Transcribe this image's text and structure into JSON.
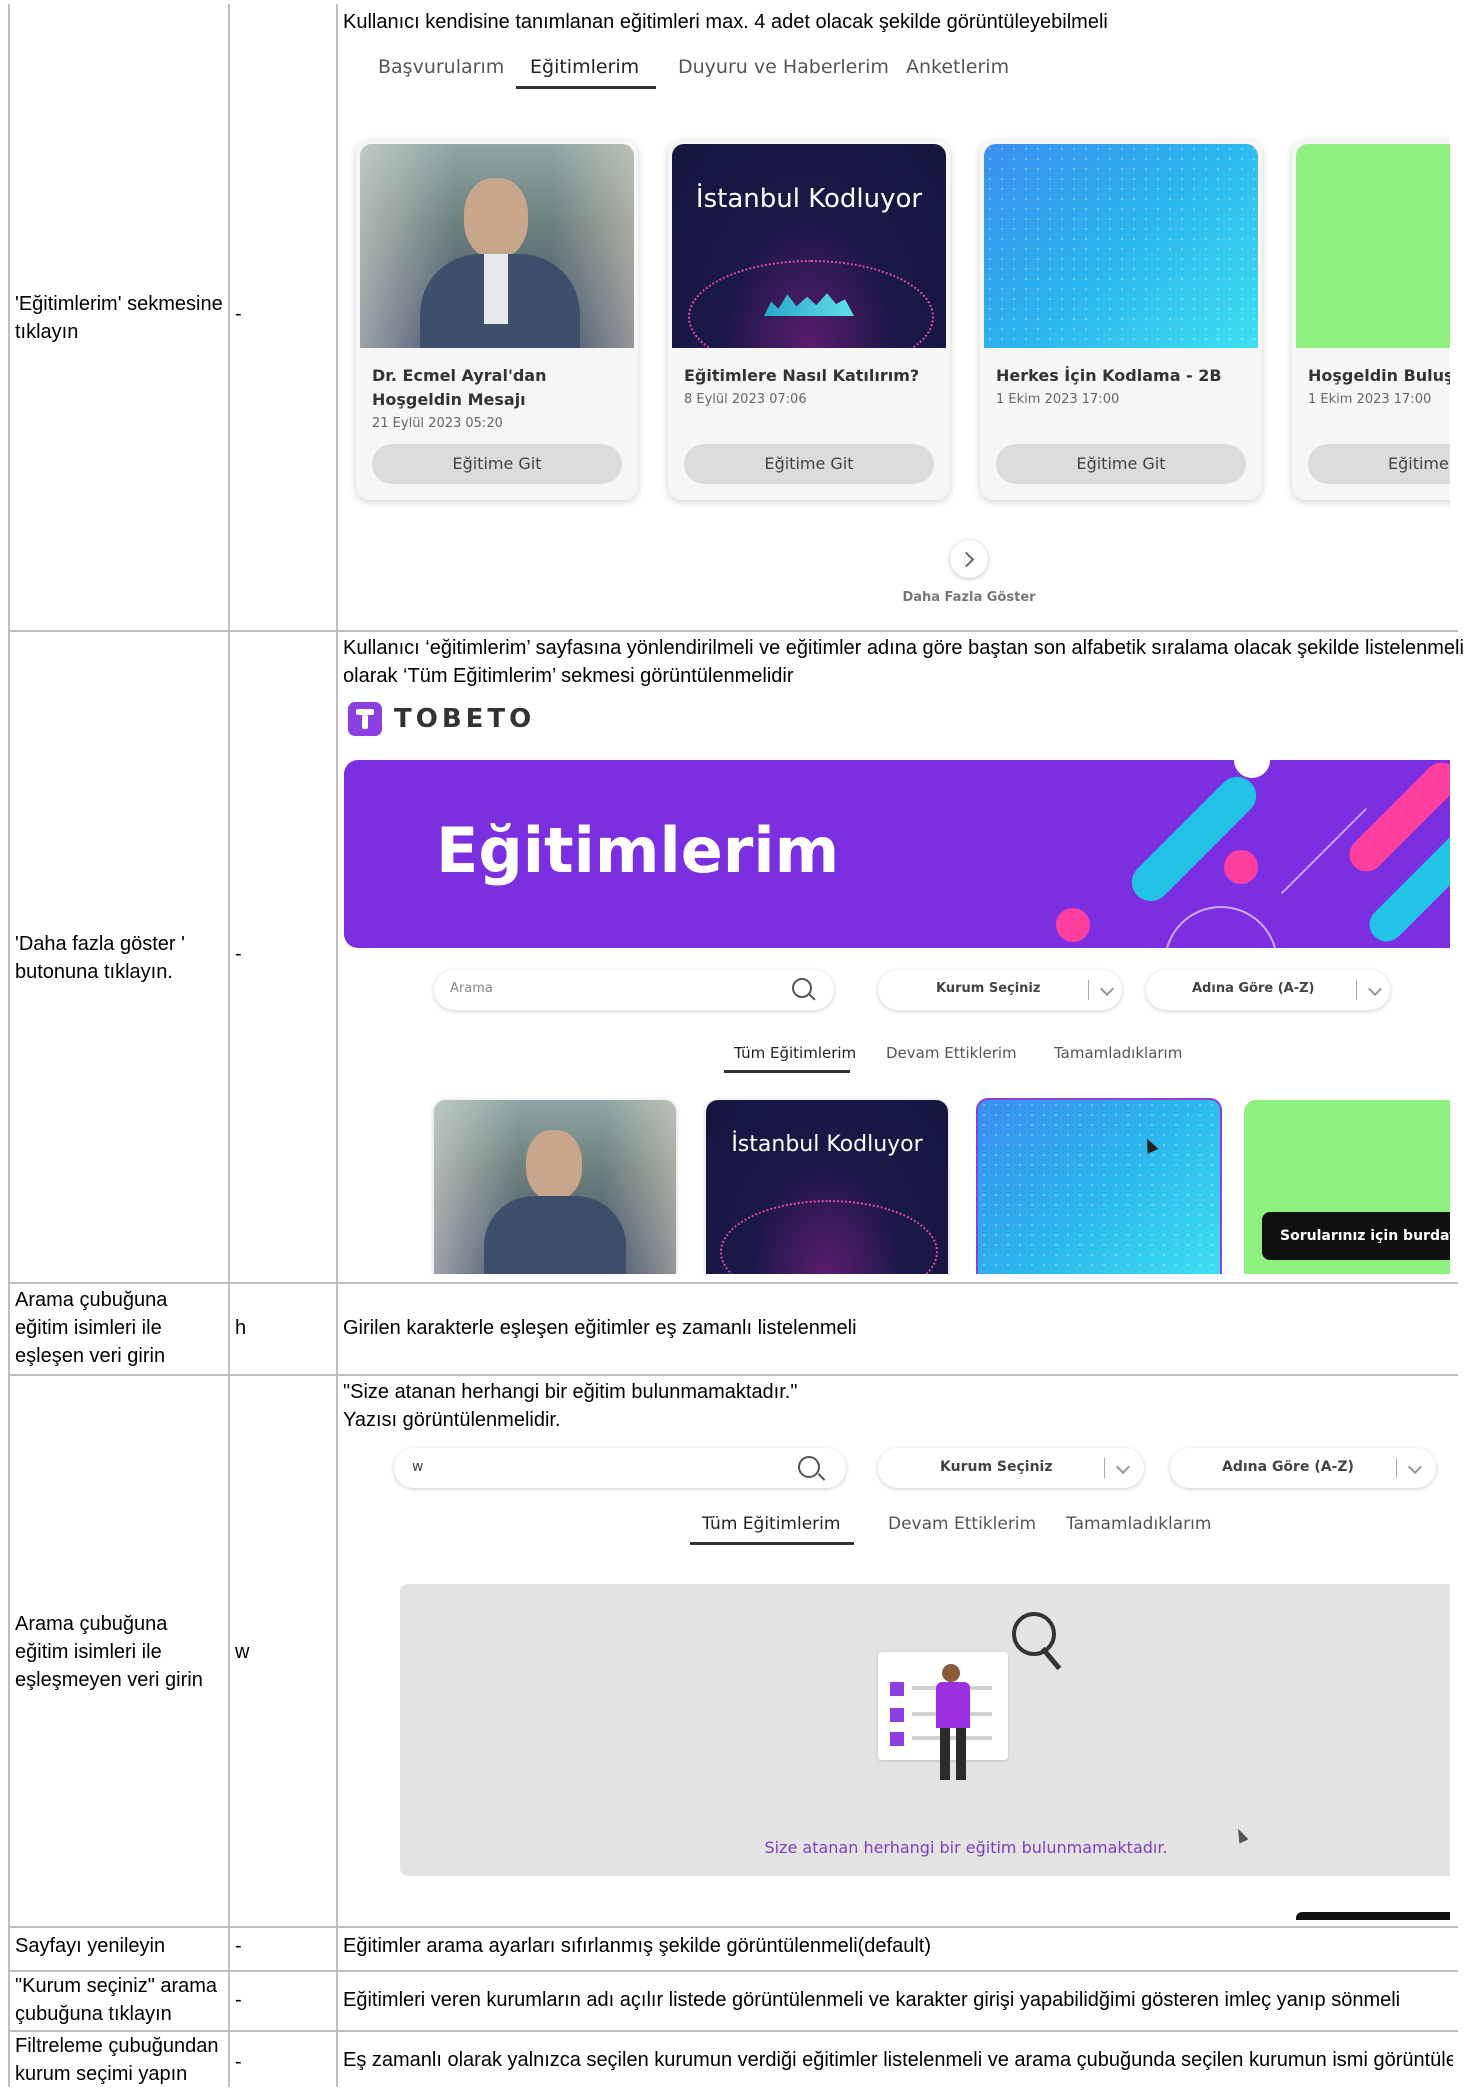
{
  "rows": [
    {
      "step": "'Eğitimlerim' sekmesine tıklayın",
      "data": "-",
      "expected": "Kullanıcı kendisine tanımlanan eğitimleri max. 4 adet olacak şekilde görüntüleyebilmeli",
      "screenshot": {
        "tabs": [
          "Başvurularım",
          "Eğitimlerim",
          "Duyuru ve Haberlerim",
          "Anketlerim"
        ],
        "active_tab": "Eğitimlerim",
        "cards": [
          {
            "title": "Dr. Ecmel Ayral'dan Hoşgeldin Mesajı",
            "date": "21 Eylül 2023 05:20",
            "button": "Eğitime Git",
            "image": "portrait-photo"
          },
          {
            "title": "Eğitimlere Nasıl Katılırım?",
            "date": "8 Eylül 2023 07:06",
            "button": "Eğitime Git",
            "image_text": "İstanbul Kodluyor"
          },
          {
            "title": "Herkes İçin Kodlama - 2B",
            "date": "1 Ekim 2023 17:00",
            "button": "Eğitime Git",
            "image": "blue-gradient"
          },
          {
            "title": "Hoşgeldin Buluşr",
            "date": "1 Ekim 2023 17:00",
            "button": "Eğitime",
            "image": "green"
          }
        ],
        "more_label": "Daha Fazla Göster"
      }
    },
    {
      "step": "'Daha fazla göster ' butonuna tıklayın.",
      "data": "-",
      "expected_line1": "Kullanıcı ‘eğitimlerim’ sayfasına yönlendirilmeli ve eğitimler adına göre baştan son alfabetik sıralama olacak şekilde listelenmeli",
      "expected_line2": "olarak ‘Tüm Eğitimlerim’ sekmesi görüntülenmelidir",
      "screenshot": {
        "logo": "TOBETO",
        "banner_title": "Eğitimlerim",
        "search_placeholder": "Arama",
        "org_select": "Kurum Seçiniz",
        "sort_select": "Adına Göre (A-Z)",
        "tabs": [
          "Tüm Eğitimlerim",
          "Devam Ettiklerim",
          "Tamamladıklarım"
        ],
        "card1_text": "İstanbul Kodluyor",
        "chat_label": "Sorularınız için burdayı"
      }
    },
    {
      "step": "Arama çubuğuna eğitim isimleri ile eşleşen veri girin",
      "data": "h",
      "expected": "Girilen karakterle eşleşen eğitimler eş zamanlı listelenmeli"
    },
    {
      "step": "Arama çubuğuna eğitim isimleri ile eşleşmeyen veri girin",
      "data": "w",
      "expected_line1": "\"Size atanan herhangi bir eğitim bulunmamaktadır.\"",
      "expected_line2": "Yazısı görüntülenmelidir.",
      "screenshot": {
        "search_value": "w",
        "org_select": "Kurum Seçiniz",
        "sort_select": "Adına Göre (A-Z)",
        "tabs": [
          "Tüm Eğitimlerim",
          "Devam Ettiklerim",
          "Tamamladıklarım"
        ],
        "empty_message": "Size atanan herhangi bir eğitim bulunmamaktadır."
      }
    },
    {
      "step": "Sayfayı yenileyin",
      "data": "-",
      "expected": "Eğitimler arama ayarları sıfırlanmış şekilde görüntülenmeli(default)"
    },
    {
      "step": "\"Kurum seçiniz\" arama çubuğuna tıklayın",
      "data": "-",
      "expected": "Eğitimleri veren kurumların adı açılır listede görüntülenmeli ve karakter girişi yapabilidğimi gösteren imleç yanıp sönmeli"
    },
    {
      "step": "Filtreleme çubuğundan kurum seçimi yapın",
      "data": "-",
      "expected": "Eş zamanlı olarak yalnızca seçilen kurumun verdiği eğitimler listelenmeli ve arama çubuğunda seçilen kurumun ismi görüntülen"
    }
  ],
  "colors": {
    "purple": "#7b2fe0",
    "accent_pink": "#ff3fa0",
    "accent_cyan": "#22c3e6",
    "green_card": "#8ef07f",
    "dark_navy": "#14163f"
  }
}
